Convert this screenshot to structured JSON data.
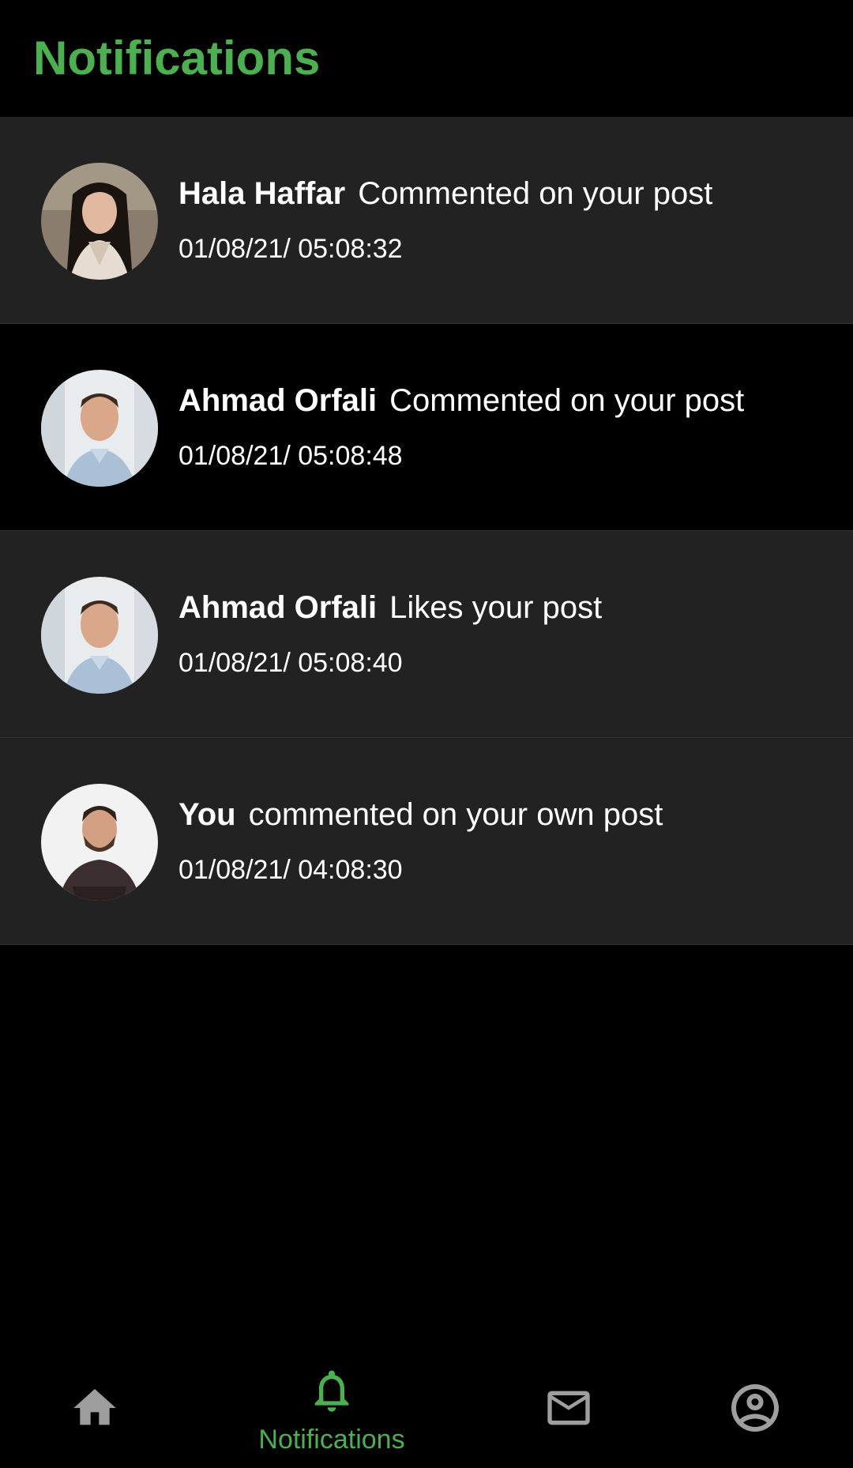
{
  "header": {
    "title": "Notifications",
    "accent_color": "#4caf50"
  },
  "notifications": [
    {
      "name": "Hala Haffar",
      "action": "Commented on your post",
      "time": "01/08/21/ 05:08:32",
      "avatar": "profile-photo-woman-long-dark-hair"
    },
    {
      "name": "Ahmad Orfali",
      "action": "Commented on your post",
      "time": "01/08/21/ 05:08:48",
      "avatar": "profile-photo-man-short-hair"
    },
    {
      "name": "Ahmad Orfali",
      "action": "Likes your post",
      "time": "01/08/21/ 05:08:40",
      "avatar": "profile-photo-man-short-hair"
    },
    {
      "name": "You",
      "action": "commented on your own post",
      "time": "01/08/21/ 04:08:30",
      "avatar": "profile-photo-man-beard"
    }
  ],
  "bottom_nav": {
    "items": [
      {
        "icon": "home-icon",
        "label": "",
        "active": false
      },
      {
        "icon": "bell-icon",
        "label": "Notifications",
        "active": true
      },
      {
        "icon": "mail-icon",
        "label": "",
        "active": false
      },
      {
        "icon": "account-circle-icon",
        "label": "",
        "active": false
      }
    ],
    "active_color": "#4caf50",
    "inactive_color": "#9e9e9e"
  }
}
